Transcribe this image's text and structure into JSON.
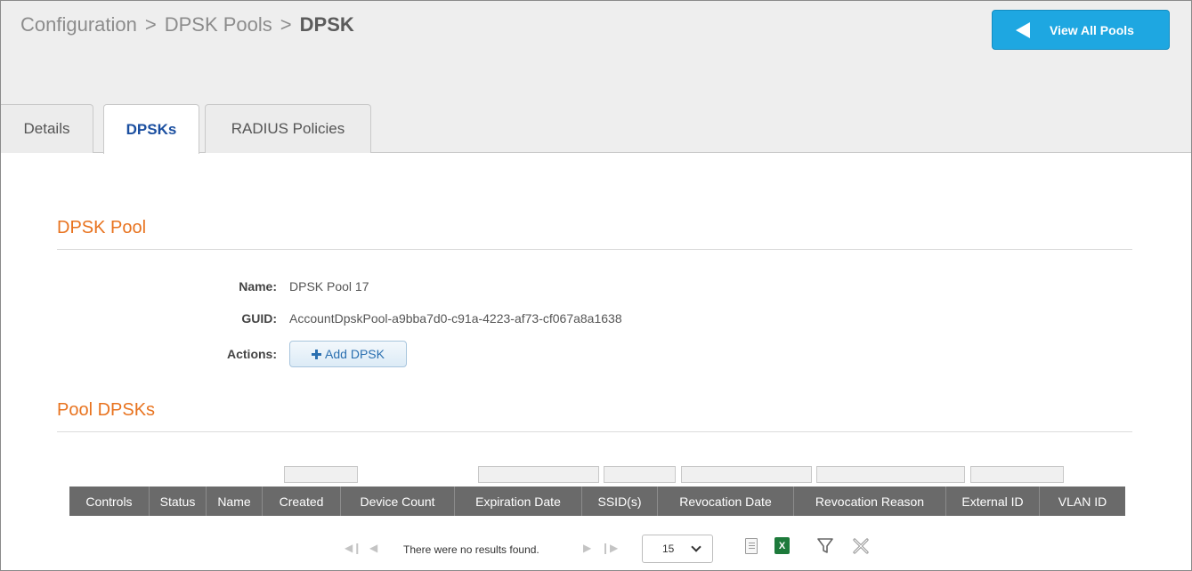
{
  "breadcrumb": {
    "items": [
      "Configuration",
      "DPSK Pools"
    ],
    "separator": ">",
    "current": "DPSK"
  },
  "header": {
    "view_all_label": "View All Pools"
  },
  "tabs": [
    {
      "label": "Details"
    },
    {
      "label": "DPSKs",
      "active": true
    },
    {
      "label": "RADIUS Policies"
    }
  ],
  "pool_section": {
    "title": "DPSK Pool",
    "name_label": "Name:",
    "name_value": "DPSK Pool 17",
    "guid_label": "GUID:",
    "guid_value": "AccountDpskPool-a9bba7d0-c91a-4223-af73-cf067a8a1638",
    "actions_label": "Actions:",
    "add_button_label": "Add DPSK"
  },
  "pool_dpsks": {
    "title": "Pool DPSKs",
    "columns": [
      "Controls",
      "Status",
      "Name",
      "Created",
      "Device Count",
      "Expiration Date",
      "SSID(s)",
      "Revocation Date",
      "Revocation Reason",
      "External ID",
      "VLAN ID"
    ]
  },
  "pager": {
    "no_results": "There were no results found.",
    "page_size": "15"
  },
  "icons": {
    "view_all": "left-triangle-icon",
    "add": "plus-icon",
    "first": "first-page-icon",
    "prev": "prev-page-icon",
    "next": "next-page-icon",
    "last": "last-page-icon",
    "export_csv": "document-icon",
    "export_excel": "excel-icon",
    "filter": "filter-icon",
    "clear_filter": "clear-filter-icon"
  },
  "colors": {
    "accent_blue": "#1ea7e1",
    "section_title": "#e8731f",
    "active_tab": "#1b4fa0",
    "table_header": "#6a6a6a"
  }
}
